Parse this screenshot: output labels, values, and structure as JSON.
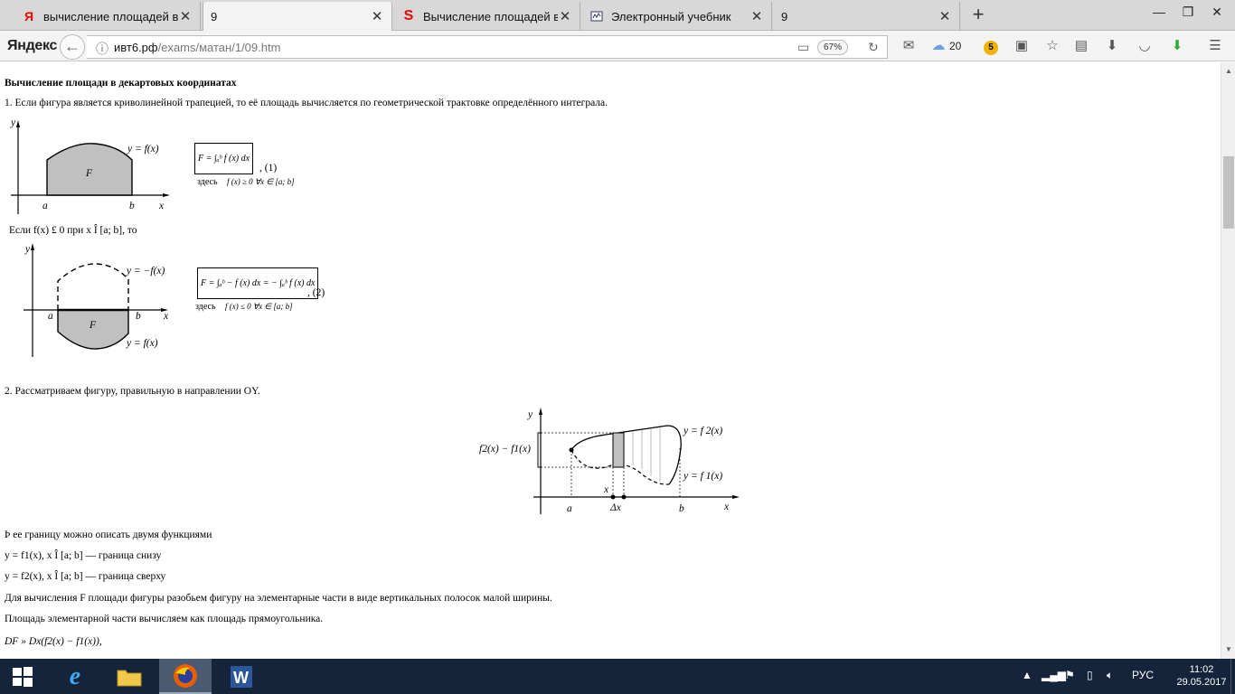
{
  "browser": {
    "tabs": [
      {
        "title": "вычисление площадей в де",
        "favicon": "Я"
      },
      {
        "title": "9",
        "favicon": ""
      },
      {
        "title": "Вычисление площадей в д",
        "favicon": "S"
      },
      {
        "title": "Электронный учебник",
        "favicon": "doc-icon"
      },
      {
        "title": "9",
        "favicon": ""
      }
    ],
    "logo": "Яндекс",
    "url_host": "ивт6.рф",
    "url_path": "/exams/матан/1/09.htm",
    "zoom": "67%",
    "weather_temp": "20",
    "badge_count": "5"
  },
  "page": {
    "heading": "Вычисление площади в декартовых координатах",
    "p1": "1. Если фигура является криволинейной трапецией, то её площадь вычисляется по геометрической трактовке определённого интеграла.",
    "fig1": {
      "y": "y",
      "x": "x",
      "a": "a",
      "b": "b",
      "F": "F",
      "curve": "y = f(x)"
    },
    "formula1": "F  =  ∫ₐᵇ f (x) dx",
    "formula1_num": ", (1)",
    "where1": "здесь",
    "cond1": "f (x) ≥ 0  ∀x ∈ [a; b]",
    "p_if": "Если f(x) £ 0 при x Î [a; b], то",
    "fig2": {
      "y": "y",
      "x": "x",
      "a": "a",
      "b": "b",
      "F": "F",
      "curve_top": "y = −f(x)",
      "curve_bottom": "y = f(x)"
    },
    "formula2": "F = ∫ₐᵇ − f (x) dx = − ∫ₐᵇ f (x) dx",
    "formula2_num": ", (2)",
    "where2": "здесь",
    "cond2": "f (x) ≤ 0  ∀x ∈ [a; b]",
    "p2": "2. Рассматриваем фигуру, правильную в направлении OY.",
    "fig3": {
      "y": "y",
      "x": "x",
      "a": "a",
      "b": "b",
      "dx": "Δx",
      "xlabel": "x",
      "f2": "y = f 2(x)",
      "f1": "y = f 1(x)",
      "diff": "f2(x) − f1(x)"
    },
    "p3": "Þ ее границу можно описать двумя функциями",
    "p4": "y = f1(x), x Î [a; b] — граница снизу",
    "p5": "y = f2(x), x Î [a; b] — граница сверху",
    "p6": "Для вычисления F площади фигуры разобьем фигуру на элементарные части в виде вертикальных полосок малой ширины.",
    "p7": "Площадь элементарной части вычисляем как площадь прямоугольника.",
    "p8": "DF » Dx(f2(x) − f1(x)),"
  },
  "taskbar": {
    "lang": "РУС",
    "time": "11:02",
    "date": "29.05.2017"
  }
}
